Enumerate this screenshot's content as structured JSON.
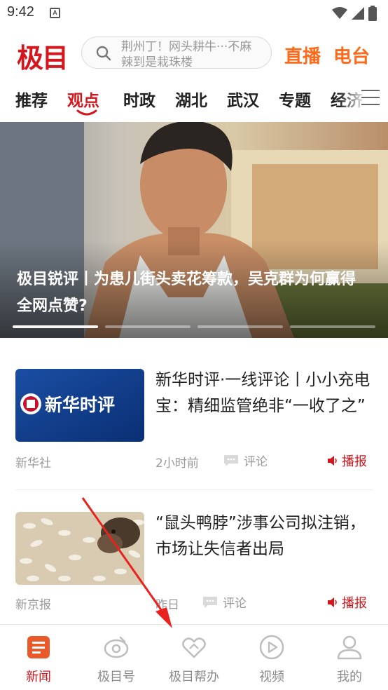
{
  "status_bar": {
    "time": "9:42",
    "indicator": "A"
  },
  "header": {
    "logo": "极目",
    "search_placeholder": "荆州丁！网头耕牛···不麻辣到是栽珠楼",
    "live_label": "直播",
    "radio_label": "电台"
  },
  "tabs": [
    {
      "label": "推荐",
      "active": false
    },
    {
      "label": "观点",
      "active": true
    },
    {
      "label": "时政",
      "active": false
    },
    {
      "label": "湖北",
      "active": false
    },
    {
      "label": "武汉",
      "active": false
    },
    {
      "label": "专题",
      "active": false
    },
    {
      "label": "经济",
      "active": false
    }
  ],
  "hero": {
    "title": "极目锐评丨为患儿街头卖花筹款，吴克群为何赢得全网点赞?",
    "slide_count": 4,
    "active_slide": 0
  },
  "articles": [
    {
      "thumb_text": "新华时评",
      "headline": "新华时评·一线评论丨小小充电宝：精细监管绝非“一收了之”",
      "source": "新华社",
      "time": "2小时前",
      "comment_label": "评论",
      "broadcast_label": "播报"
    },
    {
      "thumb_text": "",
      "headline": "“鼠头鸭脖”涉事公司拟注销，市场让失信者出局",
      "source": "新京报",
      "time": "昨日",
      "comment_label": "评论",
      "broadcast_label": "播报"
    }
  ],
  "bottom_nav": [
    {
      "label": "新闻",
      "icon": "news-icon",
      "active": true
    },
    {
      "label": "极目号",
      "icon": "jimu-account-icon",
      "active": false
    },
    {
      "label": "极目帮办",
      "icon": "help-handshake-icon",
      "active": false
    },
    {
      "label": "视频",
      "icon": "video-play-icon",
      "active": false
    },
    {
      "label": "我的",
      "icon": "profile-icon",
      "active": false
    }
  ],
  "colors": {
    "brand_red": "#d5161c",
    "accent_orange": "#ff6a1a",
    "annotation_arrow": "#e8231f"
  }
}
